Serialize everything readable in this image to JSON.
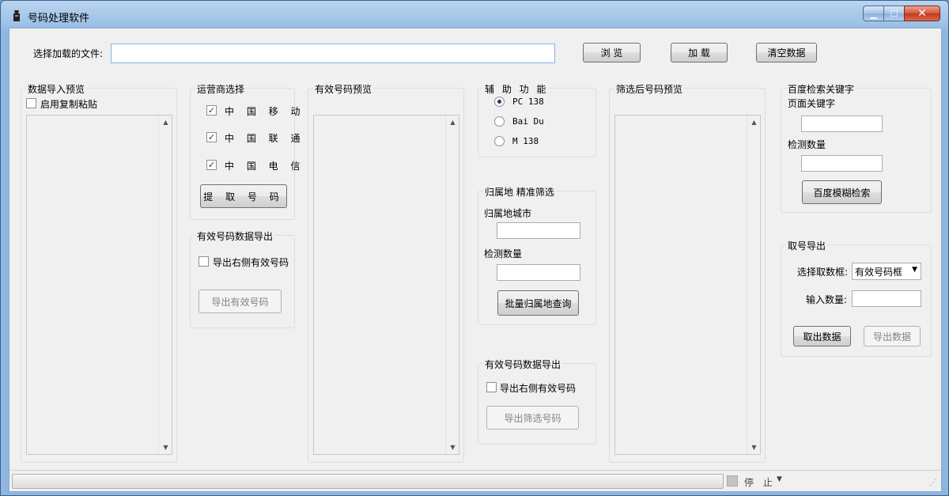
{
  "window": {
    "title": "号码处理软件"
  },
  "file_row": {
    "label": "选择加载的文件:",
    "value": "",
    "browse": "浏 览",
    "load": "加 载",
    "clear": "清空数据"
  },
  "import_preview": {
    "title": "数据导入预览",
    "paste_label": "启用复制粘贴",
    "paste_checked": false
  },
  "carrier": {
    "title": "运营商选择",
    "options": [
      {
        "label": "中 国 移 动",
        "checked": true
      },
      {
        "label": "中 国 联 通",
        "checked": true
      },
      {
        "label": "中 国 电 信",
        "checked": true
      }
    ],
    "extract": "提 取 号 码"
  },
  "valid_export": {
    "title": "有效号码数据导出",
    "check_label": "导出右侧有效号码",
    "button": "导出有效号码"
  },
  "valid_preview": {
    "title": "有效号码预览"
  },
  "aux": {
    "title": "辅 助 功 能",
    "options": [
      {
        "label": "PC 138",
        "checked": true
      },
      {
        "label": "Bai Du",
        "checked": false
      },
      {
        "label": "M 138",
        "checked": false
      }
    ]
  },
  "region": {
    "title": "归属地  精准筛选",
    "city_label": "归属地城市",
    "count_label": "检测数量",
    "button": "批量归属地查询"
  },
  "filter_export": {
    "title": "有效号码数据导出",
    "check_label": "导出右侧有效号码",
    "button": "导出筛选号码"
  },
  "filtered_preview": {
    "title": "筛选后号码预览"
  },
  "baidu": {
    "title": "百度检索关键字",
    "keyword_label": "页面关键字",
    "count_label": "检测数量",
    "button": "百度模糊检索"
  },
  "fetch": {
    "title": "取号导出",
    "select_label": "选择取数框:",
    "select_value": "有效号码框",
    "count_label": "输入数量:",
    "fetch_button": "取出数据",
    "export_button": "导出数据"
  },
  "status": {
    "stop": "停 止",
    "progress": 0
  }
}
